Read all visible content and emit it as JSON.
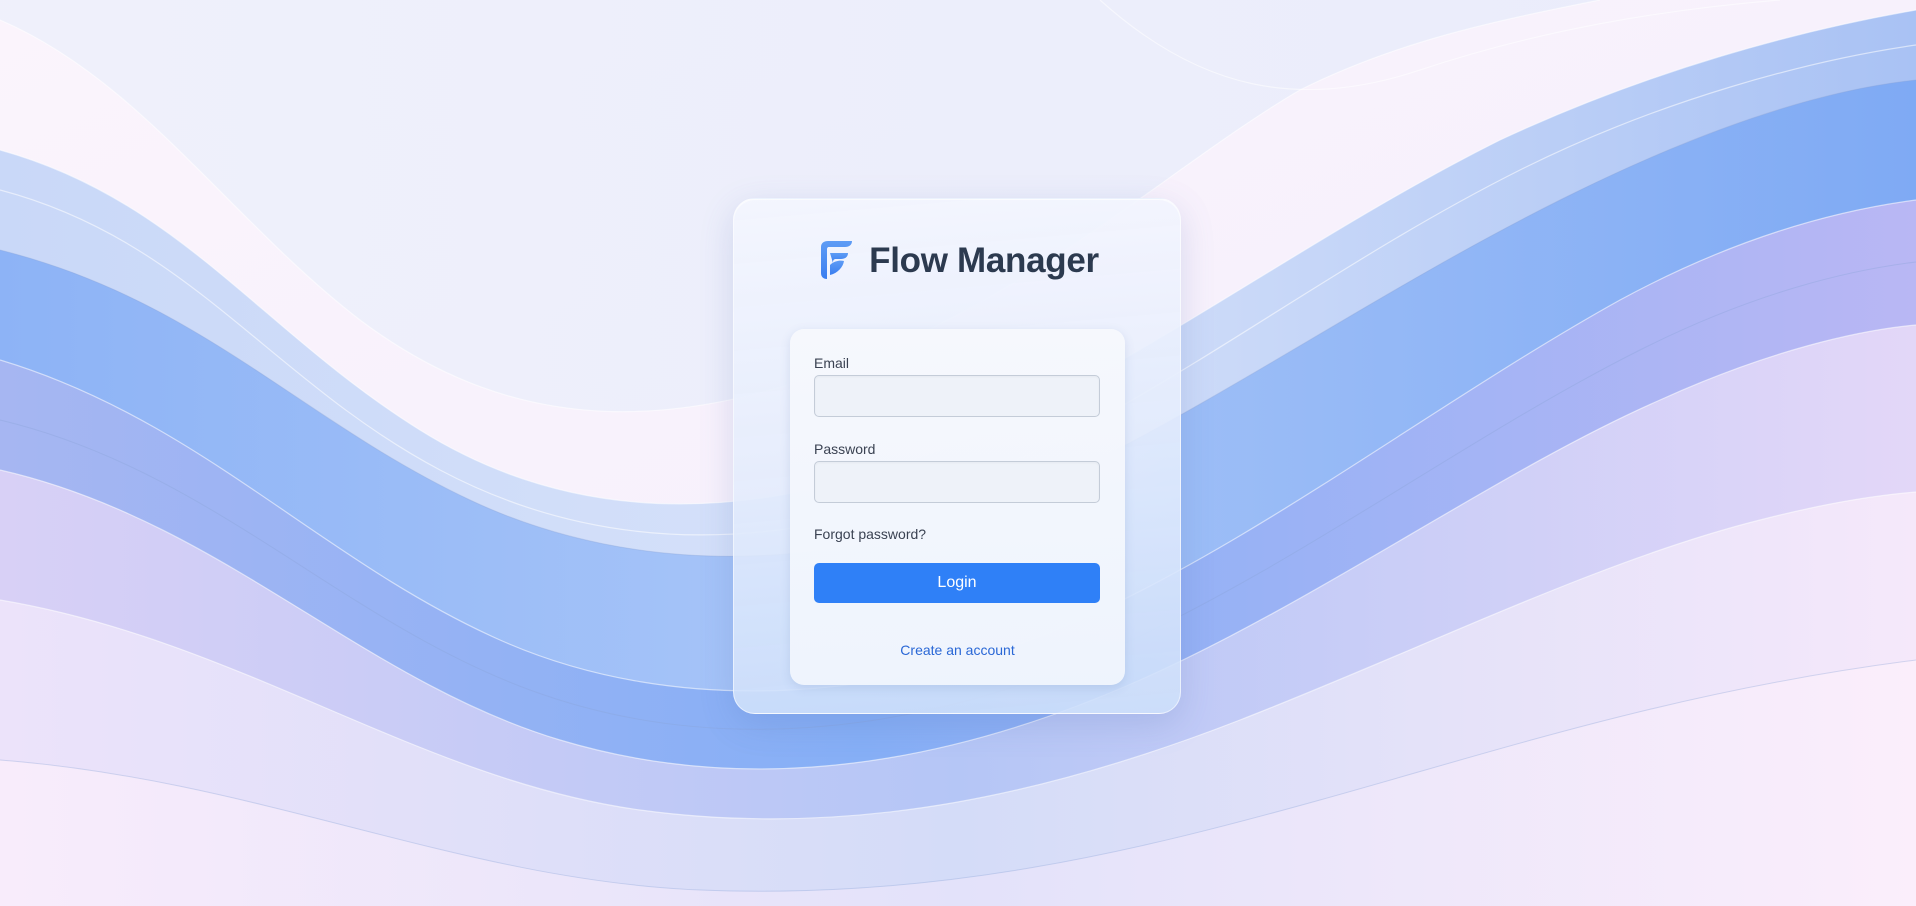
{
  "app": {
    "title": "Flow Manager",
    "logo_icon": "flow-manager-logo-icon",
    "accent_color": "#2f80f7",
    "logo_color": "#4a8bf0"
  },
  "login_form": {
    "email_label": "Email",
    "email_value": "",
    "email_placeholder": "",
    "password_label": "Password",
    "password_value": "",
    "password_placeholder": "",
    "forgot_password_text": "Forgot password?",
    "login_button_label": "Login",
    "create_account_text": "Create an account"
  }
}
